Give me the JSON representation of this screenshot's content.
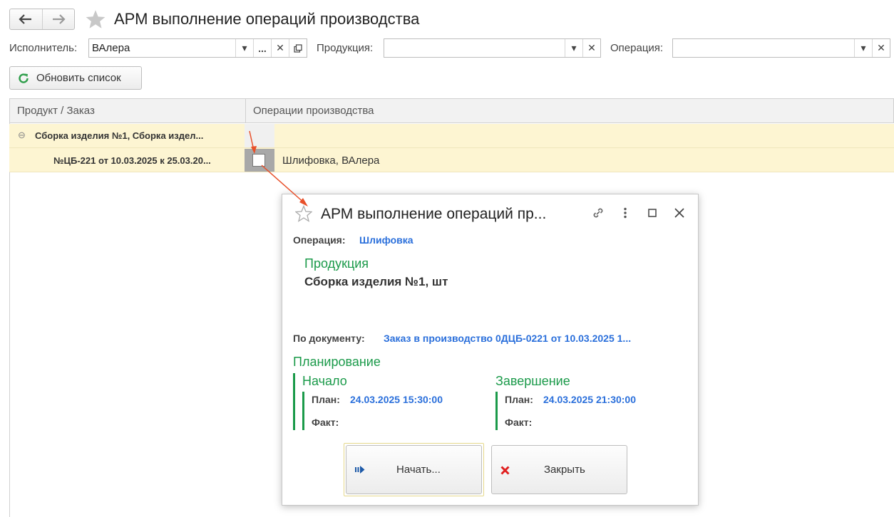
{
  "window": {
    "title": "АРМ выполнение операций производства"
  },
  "filters": {
    "executor_label": "Исполнитель:",
    "executor_value": "ВАлера",
    "product_label": "Продукция:",
    "product_value": "",
    "operation_label": "Операция:",
    "operation_value": "",
    "more_button": "..."
  },
  "toolbar": {
    "refresh_label": "Обновить список"
  },
  "table": {
    "columns": [
      "Продукт / Заказ",
      "Операции производства"
    ],
    "group_row": {
      "label": "Сборка изделия №1, Сборка издел...",
      "expanded": true
    },
    "order_row": {
      "label": "№ЦБ-221 от 10.03.2025 к 25.03.20...",
      "operation": "Шлифовка, ВАлера",
      "checked": false
    }
  },
  "dialog": {
    "title": "АРМ выполнение операций пр...",
    "operation_label": "Операция:",
    "operation_value": "Шлифовка",
    "product_header": "Продукция",
    "product_value": "Сборка изделия №1, шт",
    "document_label": "По документу:",
    "document_value": "Заказ в производство 0ДЦБ-0221 от 10.03.2025 1...",
    "planning_header": "Планирование",
    "start": {
      "header": "Начало",
      "plan_label": "План:",
      "plan_value": "24.03.2025 15:30:00",
      "fact_label": "Факт:",
      "fact_value": ""
    },
    "finish": {
      "header": "Завершение",
      "plan_label": "План:",
      "plan_value": "24.03.2025 21:30:00",
      "fact_label": "Факт:",
      "fact_value": ""
    },
    "start_button": "Начать...",
    "close_button": "Закрыть"
  },
  "colors": {
    "accent_green": "#1b9a4a",
    "link_blue": "#2a6fdb",
    "row_highlight": "#fdf5d2",
    "annotation_arrow": "#e8502a"
  }
}
